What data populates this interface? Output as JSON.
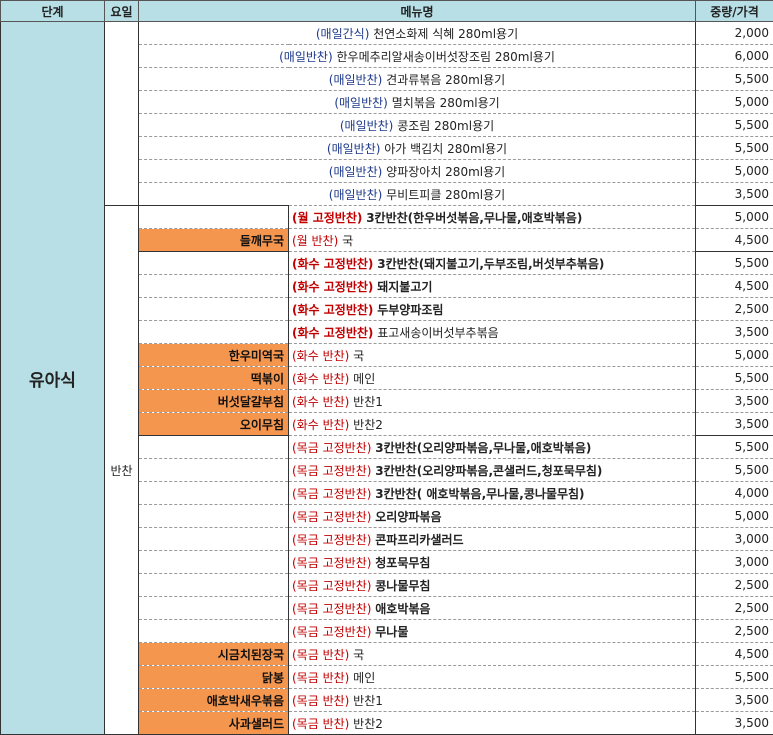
{
  "headers": {
    "stage": "단계",
    "day": "요일",
    "menu": "메뉴명",
    "price": "중량/가격"
  },
  "stage": "유아식",
  "day": "반찬",
  "colors": {
    "header_bg": "#b8dfe6",
    "stage_bg": "#b8dfe6",
    "highlight_orange": "#f5964f",
    "fixed_tag_red": "#c00000",
    "daily_tag_blue": "#1e3a8a"
  },
  "rows": [
    {
      "tag": "(매일간식)",
      "item": "천연소화제 식혜 280ml용기",
      "price": "2,000"
    },
    {
      "tag": "(매일반찬)",
      "item": "한우메추리알새송이버섯장조림 280ml용기",
      "price": "6,000"
    },
    {
      "tag": "(매일반찬)",
      "item": "견과류볶음 280ml용기",
      "price": "5,500"
    },
    {
      "tag": "(매일반찬)",
      "item": "멸치볶음 280ml용기",
      "price": "5,000"
    },
    {
      "tag": "(매일반찬)",
      "item": "콩조림 280ml용기",
      "price": "5,500"
    },
    {
      "tag": "(매일반찬)",
      "item": "아가 백김치 280ml용기",
      "price": "5,500"
    },
    {
      "tag": "(매일반찬)",
      "item": "양파장아치 280ml용기",
      "price": "5,000"
    },
    {
      "tag": "(매일반찬)",
      "item": "무비트피클 280ml용기",
      "price": "3,500"
    },
    {
      "name": "",
      "tag": "(월 고정반찬)",
      "item": "3칸반찬(한우버섯볶음,무나물,애호박볶음)",
      "price": "5,000"
    },
    {
      "name": "들깨무국",
      "tag": "(월 반찬)",
      "item": "국",
      "price": "4,500"
    },
    {
      "name": "",
      "tag": "(화수 고정반찬)",
      "item": "3칸반찬(돼지불고기,두부조림,버섯부추볶음)",
      "price": "5,500"
    },
    {
      "name": "",
      "tag": "(화수 고정반찬)",
      "item": "돼지불고기",
      "price": "4,500"
    },
    {
      "name": "",
      "tag": "(화수 고정반찬)",
      "item": "두부양파조림",
      "price": "2,500"
    },
    {
      "name": "",
      "tag": "(화수 고정반찬)",
      "item": "표고새송이버섯부추볶음",
      "price": "3,500"
    },
    {
      "name": "한우미역국",
      "tag": "(화수 반찬)",
      "item": "국",
      "price": "5,000"
    },
    {
      "name": "떡볶이",
      "tag": "(화수 반찬)",
      "item": "메인",
      "price": "5,500"
    },
    {
      "name": "버섯달걀부침",
      "tag": "(화수 반찬)",
      "item": "반찬1",
      "price": "3,500"
    },
    {
      "name": "오이무침",
      "tag": "(화수 반찬)",
      "item": "반찬2",
      "price": "3,500"
    },
    {
      "name": "",
      "tag": "(목금 고정반찬)",
      "item": "3칸반찬(오리양파볶음,무나물,애호박볶음)",
      "price": "5,500"
    },
    {
      "name": "",
      "tag": "(목금 고정반찬)",
      "item": "3칸반찬(오리양파볶음,콘샐러드,청포묵무침)",
      "price": "5,500"
    },
    {
      "name": "",
      "tag": "(목금 고정반찬)",
      "item": "3칸반찬( 애호박볶음,무나물,콩나물무침)",
      "price": "4,000"
    },
    {
      "name": "",
      "tag": "(목금 고정반찬)",
      "item": "오리양파볶음",
      "price": "5,000"
    },
    {
      "name": "",
      "tag": "(목금 고정반찬)",
      "item": "콘파프리카샐러드",
      "price": "3,000"
    },
    {
      "name": "",
      "tag": "(목금 고정반찬)",
      "item": "청포묵무침",
      "price": "3,000"
    },
    {
      "name": "",
      "tag": "(목금 고정반찬)",
      "item": "콩나물무침",
      "price": "2,500"
    },
    {
      "name": "",
      "tag": "(목금 고정반찬)",
      "item": "애호박볶음",
      "price": "2,500"
    },
    {
      "name": "",
      "tag": "(목금 고정반찬)",
      "item": "무나물",
      "price": "2,500"
    },
    {
      "name": "시금치된장국",
      "tag": "(목금 반찬)",
      "item": "국",
      "price": "4,500"
    },
    {
      "name": "닭봉",
      "tag": "(목금 반찬)",
      "item": "메인",
      "price": "5,500"
    },
    {
      "name": "애호박새우볶음",
      "tag": "(목금 반찬)",
      "item": "반찬1",
      "price": "3,500"
    },
    {
      "name": "사과샐러드",
      "tag": "(목금 반찬)",
      "item": "반찬2",
      "price": "3,500"
    }
  ]
}
